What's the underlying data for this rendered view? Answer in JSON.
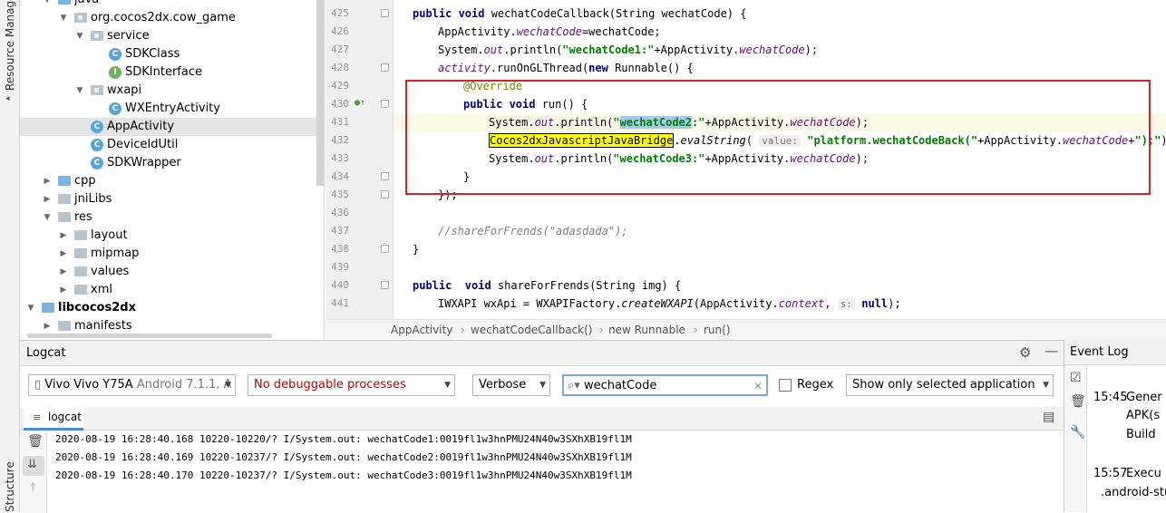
{
  "left_strip": {
    "top_label": "Resource Manager",
    "bottom_label": "Structure"
  },
  "tree": {
    "items": [
      {
        "label": "java",
        "indent": 1,
        "kind": "folder-blue",
        "arrow": "down"
      },
      {
        "label": "org.cocos2dx.cow_game",
        "indent": 2,
        "kind": "package",
        "arrow": "down"
      },
      {
        "label": "service",
        "indent": 3,
        "kind": "package",
        "arrow": "down"
      },
      {
        "label": "SDKClass",
        "indent": 4,
        "kind": "class"
      },
      {
        "label": "SDKInterface",
        "indent": 4,
        "kind": "interface"
      },
      {
        "label": "wxapi",
        "indent": 3,
        "kind": "package",
        "arrow": "down"
      },
      {
        "label": "WXEntryActivity",
        "indent": 4,
        "kind": "class"
      },
      {
        "label": "AppActivity",
        "indent": 3,
        "kind": "class",
        "selected": true
      },
      {
        "label": "DeviceIdUtil",
        "indent": 3,
        "kind": "class"
      },
      {
        "label": "SDKWrapper",
        "indent": 3,
        "kind": "class"
      },
      {
        "label": "cpp",
        "indent": 1,
        "kind": "folder-blue",
        "arrow": "right"
      },
      {
        "label": "jniLibs",
        "indent": 1,
        "kind": "folder",
        "arrow": "right"
      },
      {
        "label": "res",
        "indent": 1,
        "kind": "folder",
        "arrow": "down"
      },
      {
        "label": "layout",
        "indent": 2,
        "kind": "folder",
        "arrow": "right"
      },
      {
        "label": "mipmap",
        "indent": 2,
        "kind": "folder",
        "arrow": "right"
      },
      {
        "label": "values",
        "indent": 2,
        "kind": "folder",
        "arrow": "right"
      },
      {
        "label": "xml",
        "indent": 2,
        "kind": "folder",
        "arrow": "right"
      },
      {
        "label": "libcocos2dx",
        "indent": 0,
        "kind": "module",
        "arrow": "down",
        "bold": true
      },
      {
        "label": "manifests",
        "indent": 1,
        "kind": "folder",
        "arrow": "right"
      }
    ]
  },
  "editor": {
    "line_numbers": [
      "425",
      "426",
      "427",
      "428",
      "429",
      "430",
      "431",
      "432",
      "433",
      "434",
      "435",
      "436",
      "437",
      "438",
      "439",
      "440",
      "441"
    ],
    "hint_value": "value:",
    "hint_s": "s:"
  },
  "breadcrumb": [
    "AppActivity",
    "wechatCodeCallback()",
    "new Runnable",
    "run()"
  ],
  "logcat": {
    "title": "Logcat",
    "device": "Vivo Vivo Y75A",
    "device_suffix": "Android 7.1.1, A",
    "process": "No debuggable processes",
    "level": "Verbose",
    "search_value": "wechatCode",
    "regex_label": "Regex",
    "filter": "Show only selected application",
    "tab_label": "logcat",
    "lines": [
      "2020-08-19 16:28:40.168 10220-10220/? I/System.out: wechatCode1:0019fl1w3hnPMU24N40w3SXhXB19fl1M",
      "2020-08-19 16:28:40.169 10220-10237/? I/System.out: wechatCode2:0019fl1w3hnPMU24N40w3SXhXB19fl1M",
      "2020-08-19 16:28:40.170 10220-10237/? I/System.out: wechatCode3:0019fl1w3hnPMU24N40w3SXhXB19fl1M"
    ]
  },
  "event_log": {
    "title": "Event Log",
    "entries": [
      {
        "time": "15:45",
        "lines": [
          "Gener",
          "APK(s",
          "Build"
        ]
      },
      {
        "time": "15:57",
        "lines": [
          "Execu",
          ".android-stu"
        ]
      }
    ]
  },
  "colors": {
    "highlight_box": "#e02020",
    "keyword": "#000080",
    "string": "#008000",
    "field": "#660e7a"
  }
}
